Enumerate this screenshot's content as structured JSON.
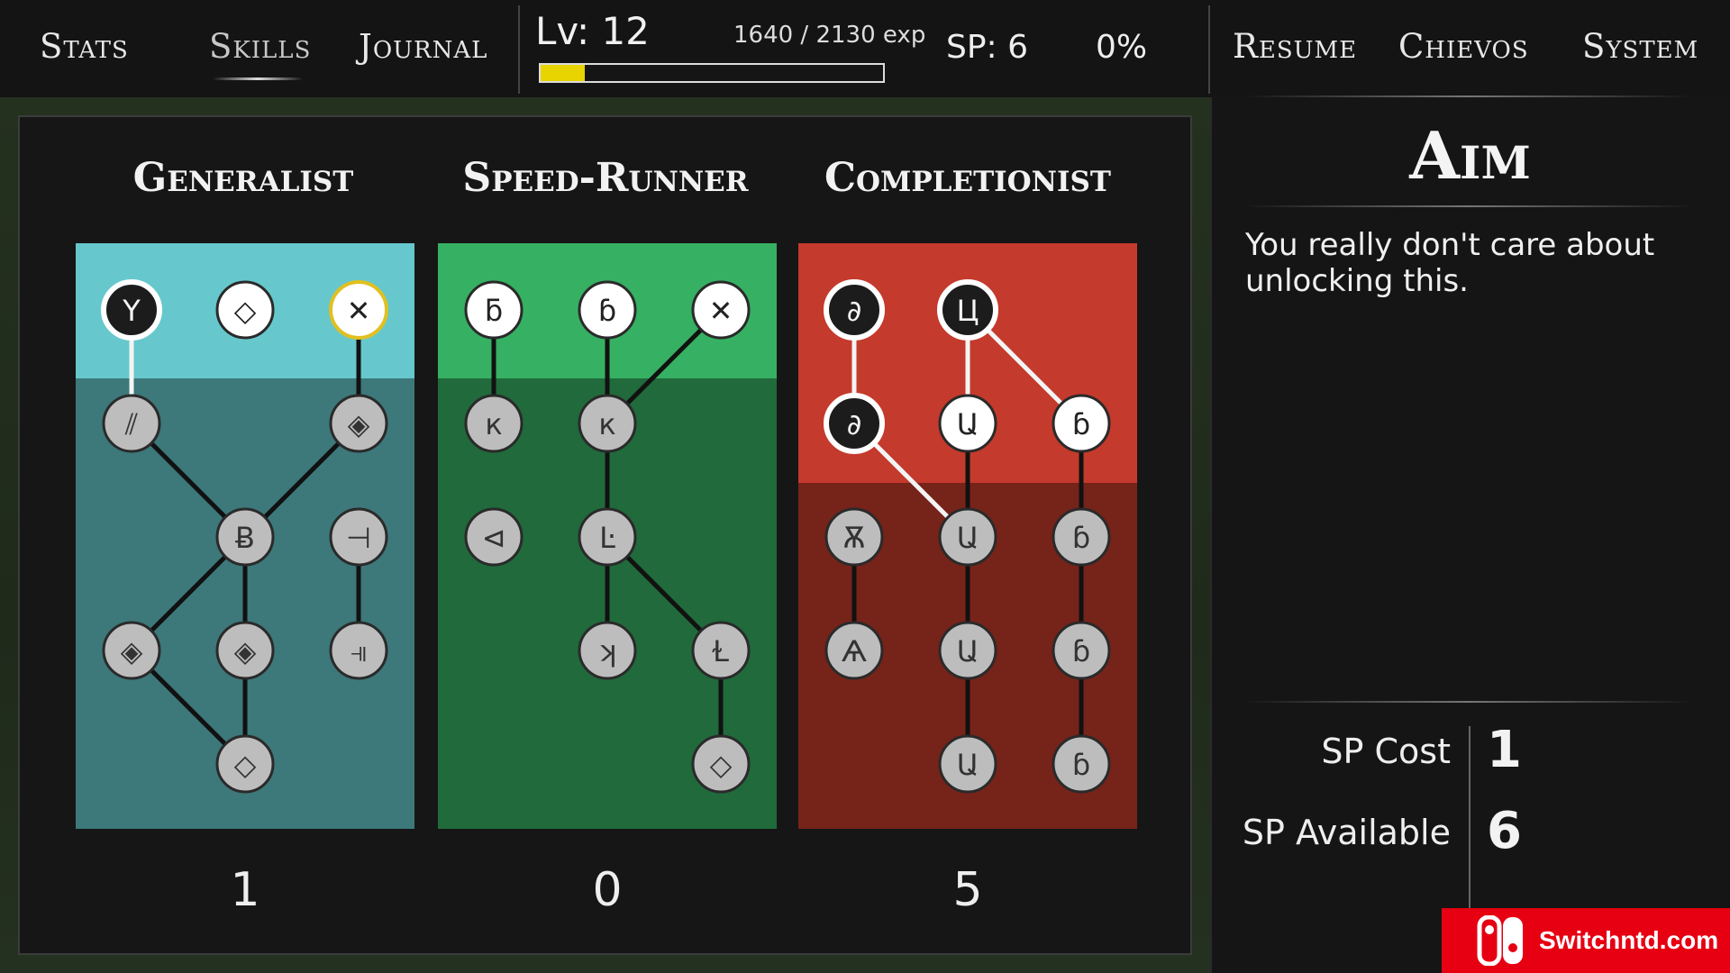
{
  "topbar": {
    "tabs": [
      {
        "label": "Stats",
        "active": false
      },
      {
        "label": "Skills",
        "active": true
      },
      {
        "label": "Journal",
        "active": false
      }
    ],
    "level": "Lv: 12",
    "exp": "1640 / 2130 exp",
    "exp_progress": 0.13,
    "sp": "SP: 6",
    "percent": "0%",
    "right_tabs": [
      "Resume",
      "Chievos",
      "System"
    ]
  },
  "colors": {
    "generalist": "#66c8cc",
    "speed_runner": "#36b062",
    "completionist": "#c43a2c",
    "xp_fill": "#e8d400"
  },
  "trees": [
    {
      "name": "Generalist",
      "count": "1",
      "nodes": [
        {
          "id": "g1",
          "row": 0,
          "col": 0,
          "state": "selected",
          "glyph": "Y"
        },
        {
          "id": "g2",
          "row": 0,
          "col": 1,
          "state": "available",
          "glyph": "◇"
        },
        {
          "id": "g3",
          "row": 0,
          "col": 2,
          "state": "available-gold",
          "glyph": "✕"
        },
        {
          "id": "g4",
          "row": 1,
          "col": 0,
          "state": "locked",
          "glyph": "⫽"
        },
        {
          "id": "g5",
          "row": 1,
          "col": 2,
          "state": "locked",
          "glyph": "◈"
        },
        {
          "id": "g6",
          "row": 2,
          "col": 1,
          "state": "locked",
          "glyph": "Ƀ"
        },
        {
          "id": "g7",
          "row": 2,
          "col": 2,
          "state": "locked",
          "glyph": "⊣"
        },
        {
          "id": "g8",
          "row": 3,
          "col": 0,
          "state": "locked",
          "glyph": "◈"
        },
        {
          "id": "g9",
          "row": 3,
          "col": 1,
          "state": "locked",
          "glyph": "◈"
        },
        {
          "id": "g10",
          "row": 3,
          "col": 2,
          "state": "locked",
          "glyph": "⫣"
        },
        {
          "id": "g11",
          "row": 4,
          "col": 1,
          "state": "locked",
          "glyph": "◇"
        }
      ],
      "edges": [
        [
          "g1",
          "g4"
        ],
        [
          "g3",
          "g5"
        ],
        [
          "g4",
          "g6"
        ],
        [
          "g5",
          "g6"
        ],
        [
          "g6",
          "g8"
        ],
        [
          "g6",
          "g9"
        ],
        [
          "g7",
          "g10"
        ],
        [
          "g8",
          "g11"
        ],
        [
          "g9",
          "g11"
        ]
      ]
    },
    {
      "name": "Speed-Runner",
      "count": "0",
      "nodes": [
        {
          "id": "s1",
          "row": 0,
          "col": 0,
          "state": "available",
          "glyph": "ƃ"
        },
        {
          "id": "s2",
          "row": 0,
          "col": 1,
          "state": "available",
          "glyph": "ɓ"
        },
        {
          "id": "s3",
          "row": 0,
          "col": 2,
          "state": "available",
          "glyph": "✕"
        },
        {
          "id": "s4",
          "row": 1,
          "col": 0,
          "state": "locked",
          "glyph": "к"
        },
        {
          "id": "s5",
          "row": 1,
          "col": 1,
          "state": "locked",
          "glyph": "к"
        },
        {
          "id": "s6",
          "row": 2,
          "col": 0,
          "state": "locked",
          "glyph": "⊲"
        },
        {
          "id": "s7",
          "row": 2,
          "col": 1,
          "state": "locked",
          "glyph": "Ŀ"
        },
        {
          "id": "s8",
          "row": 3,
          "col": 1,
          "state": "locked",
          "glyph": "ʞ"
        },
        {
          "id": "s9",
          "row": 3,
          "col": 2,
          "state": "locked",
          "glyph": "Ɫ"
        },
        {
          "id": "s10",
          "row": 4,
          "col": 2,
          "state": "locked",
          "glyph": "◇"
        }
      ],
      "edges": [
        [
          "s1",
          "s4"
        ],
        [
          "s2",
          "s5"
        ],
        [
          "s3",
          "s5"
        ],
        [
          "s5",
          "s7"
        ],
        [
          "s7",
          "s8"
        ],
        [
          "s7",
          "s9"
        ],
        [
          "s9",
          "s10"
        ]
      ]
    },
    {
      "name": "Completionist",
      "count": "5",
      "nodes": [
        {
          "id": "c1",
          "row": 0,
          "col": 0,
          "state": "selected",
          "glyph": "∂"
        },
        {
          "id": "c2",
          "row": 0,
          "col": 1,
          "state": "selected",
          "glyph": "Ц"
        },
        {
          "id": "c3",
          "row": 1,
          "col": 0,
          "state": "selected",
          "glyph": "∂"
        },
        {
          "id": "c4",
          "row": 1,
          "col": 1,
          "state": "available",
          "glyph": "Ա"
        },
        {
          "id": "c5",
          "row": 1,
          "col": 2,
          "state": "available",
          "glyph": "ɓ"
        },
        {
          "id": "c6",
          "row": 2,
          "col": 0,
          "state": "locked",
          "glyph": "Ѫ"
        },
        {
          "id": "c7",
          "row": 2,
          "col": 1,
          "state": "locked",
          "glyph": "Ա"
        },
        {
          "id": "c8",
          "row": 2,
          "col": 2,
          "state": "locked",
          "glyph": "ɓ"
        },
        {
          "id": "c9",
          "row": 3,
          "col": 0,
          "state": "locked",
          "glyph": "Ѧ"
        },
        {
          "id": "c10",
          "row": 3,
          "col": 1,
          "state": "locked",
          "glyph": "Ա"
        },
        {
          "id": "c11",
          "row": 3,
          "col": 2,
          "state": "locked",
          "glyph": "ɓ"
        },
        {
          "id": "c12",
          "row": 4,
          "col": 1,
          "state": "locked",
          "glyph": "Ա"
        },
        {
          "id": "c13",
          "row": 4,
          "col": 2,
          "state": "locked",
          "glyph": "ɓ"
        }
      ],
      "edges": [
        [
          "c1",
          "c3"
        ],
        [
          "c2",
          "c4"
        ],
        [
          "c2",
          "c5"
        ],
        [
          "c3",
          "c7"
        ],
        [
          "c4",
          "c7"
        ],
        [
          "c5",
          "c8"
        ],
        [
          "c6",
          "c9"
        ],
        [
          "c7",
          "c10"
        ],
        [
          "c8",
          "c11"
        ],
        [
          "c10",
          "c12"
        ],
        [
          "c11",
          "c13"
        ]
      ]
    }
  ],
  "detail": {
    "title": "Aim",
    "description": "You really don't care about unlocking this.",
    "sp_cost_label": "SP Cost",
    "sp_cost_value": "1",
    "sp_available_label": "SP Available",
    "sp_available_value": "6"
  },
  "watermark": "Switchntd.com"
}
